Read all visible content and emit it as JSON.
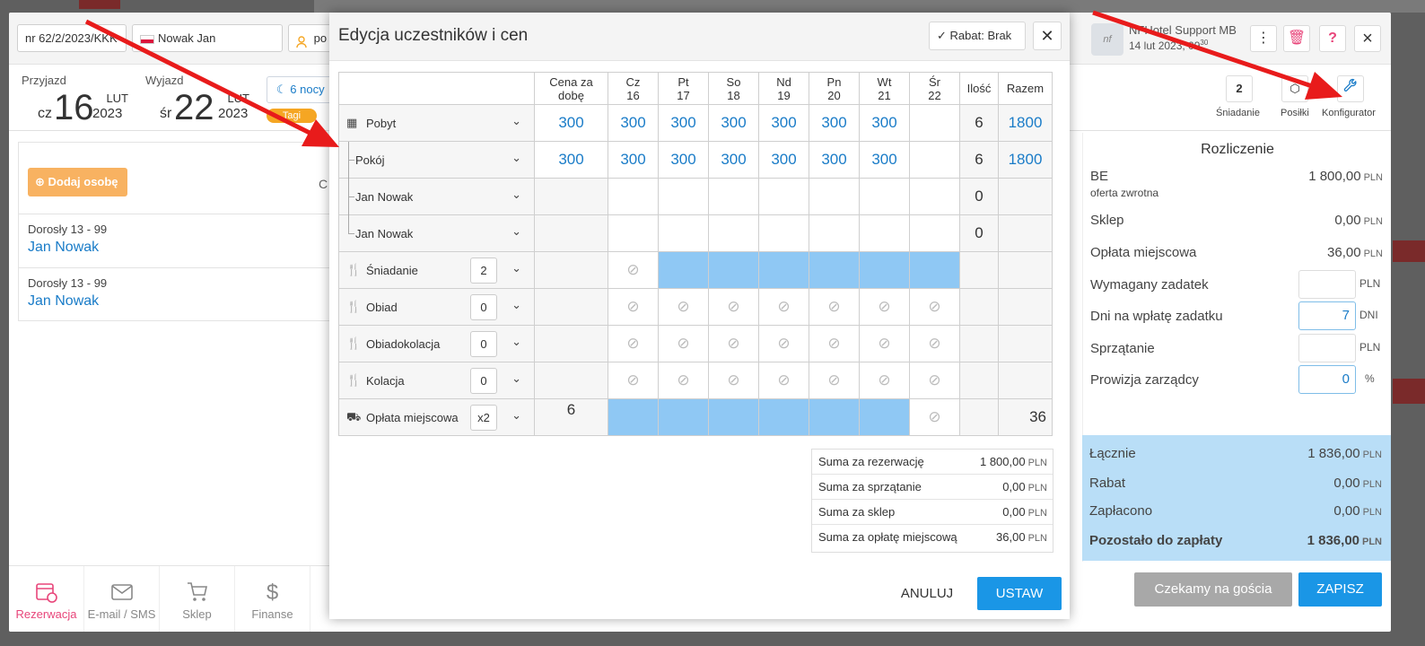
{
  "reservation": {
    "number": "nr 62/2/2023/KKK",
    "guest": "Nowak Jan",
    "people_field": "po",
    "arrival_label": "Przyjazd",
    "arrival_dow": "cz",
    "arrival_day": "16",
    "arrival_month": "LUT",
    "arrival_year": "2023",
    "departure_label": "Wyjazd",
    "departure_dow": "śr",
    "departure_day": "22",
    "departure_month": "LUT",
    "departure_year": "2023",
    "nights": "6 nocy",
    "tag": "Tagi",
    "add_person": "Dodaj osobę",
    "persons_hint": "C",
    "guests": [
      {
        "category": "Dorosły 13 - 99",
        "name": "Jan Nowak"
      },
      {
        "category": "Dorosły 13 - 99",
        "name": "Jan Nowak"
      }
    ]
  },
  "nav": {
    "items": [
      {
        "label": "Rezerwacja",
        "icon": "calendar-clock-icon"
      },
      {
        "label": "E-mail / SMS",
        "icon": "envelope-icon"
      },
      {
        "label": "Sklep",
        "icon": "cart-icon"
      },
      {
        "label": "Finanse",
        "icon": "dollar-icon"
      }
    ]
  },
  "support": {
    "name": "NFHotel Support MB",
    "time": "14 lut 2023, 09",
    "time_sup": "30"
  },
  "quick": {
    "breakfast_count": "2",
    "breakfast_label": "Śniadanie",
    "meals_label": "Posiłki",
    "config_label": "Konfigurator"
  },
  "settlement": {
    "title": "Rozliczenie",
    "currency": "PLN",
    "be_label": "BE",
    "be_sub": "oferta zwrotna",
    "be_value": "1 800,00",
    "shop_label": "Sklep",
    "shop_value": "0,00",
    "tax_label": "Opłata miejscowa",
    "tax_value": "36,00",
    "deposit_label": "Wymagany zadatek",
    "deposit_value": "",
    "days_label": "Dni na wpłatę zadatku",
    "days_value": "7",
    "days_unit": "DNI",
    "cleaning_label": "Sprzątanie",
    "cleaning_value": "",
    "commission_label": "Prowizja zarządcy",
    "commission_value": "0",
    "percent": "%",
    "total_label": "Łącznie",
    "total_value": "1 836,00",
    "discount_label": "Rabat",
    "discount_value": "0,00",
    "paid_label": "Zapłacono",
    "paid_value": "0,00",
    "remaining_label": "Pozostało do zapłaty",
    "remaining_value": "1 836,00"
  },
  "footer": {
    "waiting": "Czekamy na gościa",
    "save": "ZAPISZ"
  },
  "modal": {
    "title": "Edycja uczestników i cen",
    "discount": "Rabat: Brak",
    "headers": {
      "price_line1": "Cena za",
      "price_line2": "dobę",
      "days": [
        {
          "dow": "Cz",
          "d": "16"
        },
        {
          "dow": "Pt",
          "d": "17"
        },
        {
          "dow": "So",
          "d": "18"
        },
        {
          "dow": "Nd",
          "d": "19"
        },
        {
          "dow": "Pn",
          "d": "20"
        },
        {
          "dow": "Wt",
          "d": "21"
        },
        {
          "dow": "Śr",
          "d": "22"
        }
      ],
      "qty": "Ilość",
      "total": "Razem"
    },
    "rows": {
      "stay": {
        "label": "Pobyt",
        "price": "300",
        "days": [
          "300",
          "300",
          "300",
          "300",
          "300",
          "300",
          ""
        ],
        "qty": "6",
        "total": "1800"
      },
      "room": {
        "label": "Pokój",
        "price": "300",
        "days": [
          "300",
          "300",
          "300",
          "300",
          "300",
          "300",
          ""
        ],
        "qty": "6",
        "total": "1800"
      },
      "guest1": {
        "label": "Jan Nowak",
        "qty": "0"
      },
      "guest2": {
        "label": "Jan Nowak",
        "qty": "0"
      },
      "breakfast": {
        "label": "Śniadanie",
        "count": "2"
      },
      "lunch": {
        "label": "Obiad",
        "count": "0"
      },
      "lunchdinner": {
        "label": "Obiadokolacja",
        "count": "0"
      },
      "dinner": {
        "label": "Kolacja",
        "count": "0"
      },
      "citytax": {
        "label": "Opłata miejscowa",
        "count": "x2",
        "price": "6",
        "total": "36"
      }
    },
    "sums": [
      {
        "label": "Suma za rezerwację",
        "value": "1 800,00"
      },
      {
        "label": "Suma za sprzątanie",
        "value": "0,00"
      },
      {
        "label": "Suma za sklep",
        "value": "0,00"
      },
      {
        "label": "Suma za opłatę miejscową",
        "value": "36,00"
      }
    ],
    "currency": "PLN",
    "cancel": "ANULUJ",
    "set": "USTAW"
  }
}
